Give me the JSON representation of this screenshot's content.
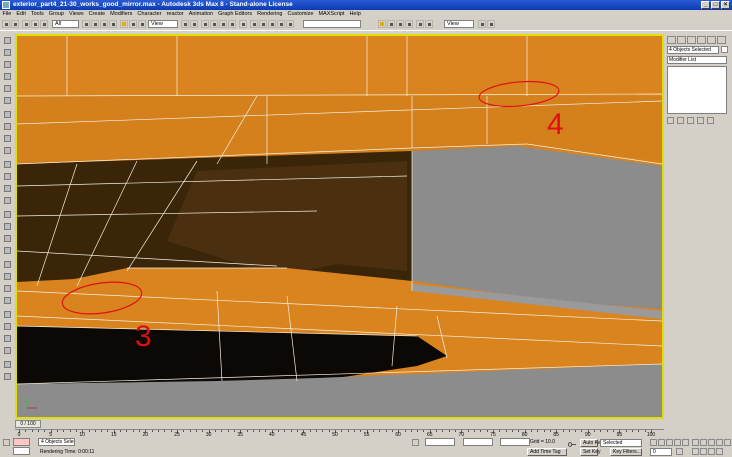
{
  "window": {
    "title": "exterior_part4_21-30_works_good_mirror.max - Autodesk 3ds Max 8 - Stand-alone License"
  },
  "menu": [
    "File",
    "Edit",
    "Tools",
    "Group",
    "Views",
    "Create",
    "Modifiers",
    "Character",
    "reactor",
    "Animation",
    "Graph Editors",
    "Rendering",
    "Customize",
    "MAXScript",
    "Help"
  ],
  "toolbar": {
    "selection_filter": "All",
    "ref_coord": "View",
    "named_selection": "",
    "view_dropdown": "View"
  },
  "command_panel": {
    "object_name": "4 Objects Selected",
    "modifier_list": "Modifier List"
  },
  "timeline": {
    "slider_label": "0 / 100"
  },
  "ruler": {
    "ticks": [
      "0",
      "5",
      "10",
      "15",
      "20",
      "25",
      "30",
      "35",
      "40",
      "45",
      "50",
      "55",
      "60",
      "65",
      "70",
      "75",
      "80",
      "85",
      "90",
      "95",
      "100"
    ]
  },
  "status": {
    "selection": "4 Objects Selected",
    "render_time": "Rendering Time: 0:00:11",
    "grid": "Grid = 10.0",
    "add_time_tag": "Add Time Tag",
    "auto_key": "Auto Key",
    "selected": "Selected",
    "set_key": "Set Key",
    "key_filters": "Key Filters...",
    "frame": "0"
  },
  "annotations": {
    "label_3": "3",
    "label_4": "4"
  },
  "colors": {
    "orange": "#d9841e",
    "dark": "#3a2508",
    "gray": "#8c8c8c",
    "red": "#e01010"
  }
}
